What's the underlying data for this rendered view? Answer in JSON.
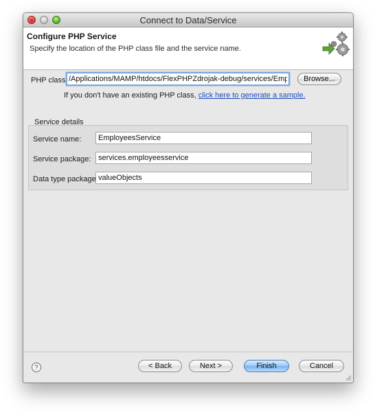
{
  "window": {
    "title": "Connect to Data/Service"
  },
  "header": {
    "title": "Configure PHP Service",
    "subtitle": "Specify the location of the PHP class file and the service name.",
    "icon": "gears-arrow-icon"
  },
  "php_class": {
    "label": "PHP class:",
    "value": "/Applications/MAMP/htdocs/FlexPHPZdrojak-debug/services/EmployeesService.php",
    "browse_label": "Browse..."
  },
  "hint": {
    "text": "If you don't have an existing PHP class, ",
    "link": "click here to generate a sample."
  },
  "service_details": {
    "title": "Service details",
    "service_name_label": "Service name:",
    "service_name_value": "EmployeesService",
    "service_package_label": "Service package:",
    "service_package_value": "services.employeesservice",
    "data_type_package_label": "Data type package:",
    "data_type_package_value": "valueObjects"
  },
  "footer": {
    "help_symbol": "?",
    "back_label": "< Back",
    "next_label": "Next >",
    "finish_label": "Finish",
    "cancel_label": "Cancel"
  },
  "colors": {
    "default_button": "#76b1ec",
    "link": "#1c4cc1",
    "focus_ring": "#7aa7dc"
  }
}
